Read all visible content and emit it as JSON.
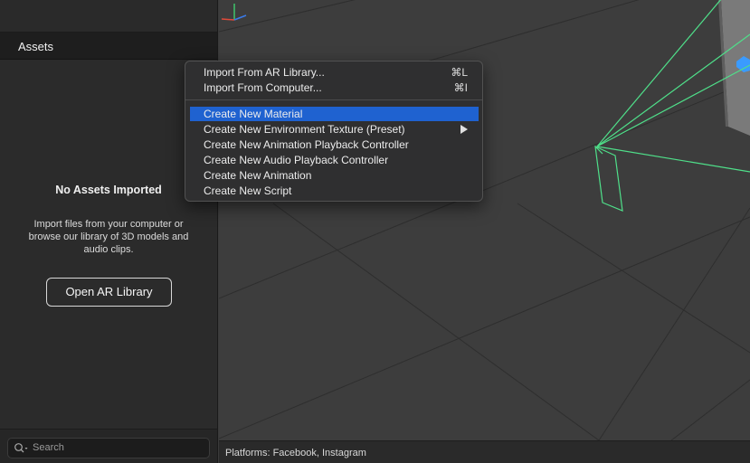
{
  "assets_panel": {
    "title": "Assets",
    "empty_title": "No Assets Imported",
    "empty_description": "Import files from your computer or browse our library of 3D models and audio clips.",
    "open_library_label": "Open AR Library",
    "search_placeholder": "Search"
  },
  "status_bar": {
    "platforms_text": "Platforms: Facebook, Instagram"
  },
  "context_menu": {
    "items": [
      {
        "label": "Import From AR Library...",
        "shortcut": "⌘L",
        "highlighted": false,
        "submenu": false
      },
      {
        "label": "Import From Computer...",
        "shortcut": "⌘I",
        "highlighted": false,
        "submenu": false
      },
      {
        "label": "Create New Material",
        "shortcut": "",
        "highlighted": true,
        "submenu": false
      },
      {
        "label": "Create New Environment Texture (Preset)",
        "shortcut": "",
        "highlighted": false,
        "submenu": true
      },
      {
        "label": "Create New Animation Playback Controller",
        "shortcut": "",
        "highlighted": false,
        "submenu": false
      },
      {
        "label": "Create New Audio Playback Controller",
        "shortcut": "",
        "highlighted": false,
        "submenu": false
      },
      {
        "label": "Create New Animation",
        "shortcut": "",
        "highlighted": false,
        "submenu": false
      },
      {
        "label": "Create New Script",
        "shortcut": "",
        "highlighted": false,
        "submenu": false
      }
    ]
  },
  "colors": {
    "menu_highlight": "#1f62d0",
    "camera_frustum": "#4fe08a",
    "selection_blue": "#3a9bff",
    "axis_x": "#e04a3a",
    "axis_y": "#3fc46b",
    "axis_z": "#3a7bea"
  },
  "icons": {
    "search": "magnifier-with-dropdown-icon",
    "submenu": "triangle-right-icon",
    "gizmo": "axis-gizmo-icon"
  }
}
